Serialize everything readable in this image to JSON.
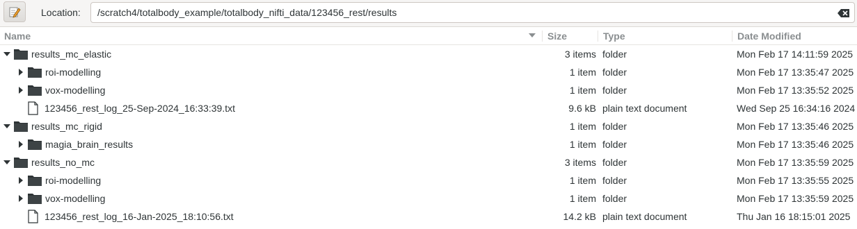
{
  "toolbar": {
    "location_label": "Location:",
    "location_value": "/scratch4/totalbody_example/totalbody_nifti_data/123456_rest/results"
  },
  "columns": {
    "name": "Name",
    "size": "Size",
    "type": "Type",
    "date": "Date Modified"
  },
  "rows": [
    {
      "name": "results_mc_elastic",
      "size": "3 items",
      "type": "folder",
      "date": "Mon Feb 17 14:11:59 2025",
      "kind": "folder",
      "level": 0,
      "expanded": true
    },
    {
      "name": "roi-modelling",
      "size": "1 item",
      "type": "folder",
      "date": "Mon Feb 17 13:35:47 2025",
      "kind": "folder",
      "level": 1,
      "expanded": false
    },
    {
      "name": "vox-modelling",
      "size": "1 item",
      "type": "folder",
      "date": "Mon Feb 17 13:35:52 2025",
      "kind": "folder",
      "level": 1,
      "expanded": false
    },
    {
      "name": "123456_rest_log_25-Sep-2024_16:33:39.txt",
      "size": "9.6 kB",
      "type": "plain text document",
      "date": "Wed Sep 25 16:34:16 2024",
      "kind": "file",
      "level": 1,
      "expanded": null
    },
    {
      "name": "results_mc_rigid",
      "size": "1 item",
      "type": "folder",
      "date": "Mon Feb 17 13:35:46 2025",
      "kind": "folder",
      "level": 0,
      "expanded": true
    },
    {
      "name": "magia_brain_results",
      "size": "1 item",
      "type": "folder",
      "date": "Mon Feb 17 13:35:46 2025",
      "kind": "folder",
      "level": 1,
      "expanded": false
    },
    {
      "name": "results_no_mc",
      "size": "3 items",
      "type": "folder",
      "date": "Mon Feb 17 13:35:59 2025",
      "kind": "folder",
      "level": 0,
      "expanded": true
    },
    {
      "name": "roi-modelling",
      "size": "1 item",
      "type": "folder",
      "date": "Mon Feb 17 13:35:55 2025",
      "kind": "folder",
      "level": 1,
      "expanded": false
    },
    {
      "name": "vox-modelling",
      "size": "1 item",
      "type": "folder",
      "date": "Mon Feb 17 13:35:59 2025",
      "kind": "folder",
      "level": 1,
      "expanded": false
    },
    {
      "name": "123456_rest_log_16-Jan-2025_18:10:56.txt",
      "size": "14.2 kB",
      "type": "plain text document",
      "date": "Thu Jan 16 18:15:01 2025",
      "kind": "file",
      "level": 1,
      "expanded": null
    }
  ]
}
